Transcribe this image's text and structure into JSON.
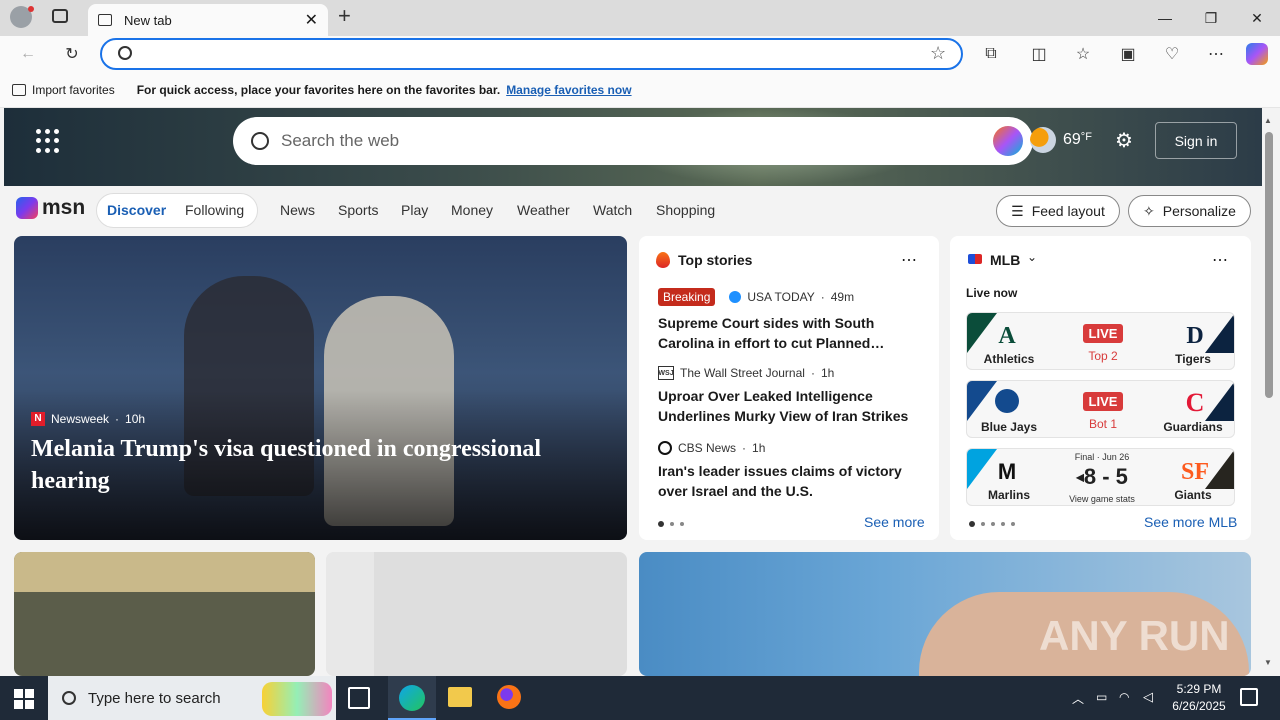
{
  "browser": {
    "tab_title": "New tab",
    "favorites_bar": {
      "import_label": "Import favorites",
      "message": "For quick access, place your favorites here on the favorites bar.",
      "manage_link": "Manage favorites now"
    }
  },
  "msn": {
    "search_placeholder": "Search the web",
    "weather_temp": "69",
    "weather_unit": "°F",
    "sign_in": "Sign in",
    "logo_text": "msn",
    "nav": [
      "Discover",
      "Following",
      "News",
      "Sports",
      "Play",
      "Money",
      "Weather",
      "Watch",
      "Shopping"
    ],
    "feed_layout": "Feed layout",
    "personalize": "Personalize"
  },
  "hero": {
    "source": "Newsweek",
    "age": "10h",
    "title": "Melania Trump's visa questioned in congressional hearing"
  },
  "top_stories": {
    "title": "Top stories",
    "stories": [
      {
        "badge": "Breaking",
        "source": "USA TODAY",
        "age": "49m",
        "headline": "Supreme Court sides with South Carolina in effort to cut Planned…"
      },
      {
        "source_logo": "WSJ",
        "source": "The Wall Street Journal",
        "age": "1h",
        "headline": "Uproar Over Leaked Intelligence Underlines Murky View of Iran Strikes"
      },
      {
        "source": "CBS News",
        "age": "1h",
        "headline": "Iran's leader issues claims of victory over Israel and the U.S."
      }
    ],
    "see_more": "See more"
  },
  "mlb": {
    "title": "MLB",
    "live_now": "Live now",
    "games": [
      {
        "away": "Athletics",
        "home": "Tigers",
        "status": "LIVE",
        "inning": "Top 2",
        "away_color": "#0b4d3a",
        "home_color": "#0c2340"
      },
      {
        "away": "Blue Jays",
        "home": "Guardians",
        "status": "LIVE",
        "inning": "Bot 1",
        "away_color": "#134a8e",
        "home_color": "#0c2340"
      },
      {
        "away": "Marlins",
        "home": "Giants",
        "final": "Final · Jun 26",
        "away_score": "8",
        "dash": "-",
        "home_score": "5",
        "stats": "View game stats",
        "away_color": "#00a3e0",
        "home_color": "#27251f"
      }
    ],
    "see_more": "See more MLB"
  },
  "taskbar": {
    "search_placeholder": "Type here to search",
    "time": "5:29 PM",
    "date": "6/26/2025"
  },
  "watermark": "ANY RUN"
}
